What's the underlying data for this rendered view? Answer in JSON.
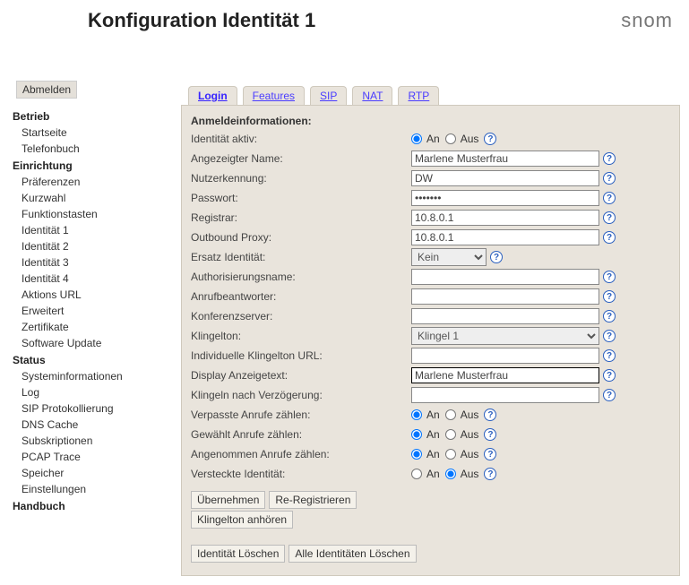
{
  "title": "Konfiguration Identität 1",
  "brand": "snom",
  "sidebar": {
    "logout": "Abmelden",
    "sections": [
      {
        "header": "Betrieb",
        "items": [
          "Startseite",
          "Telefonbuch"
        ]
      },
      {
        "header": "Einrichtung",
        "items": [
          "Präferenzen",
          "Kurzwahl",
          "Funktionstasten",
          "Identität 1",
          "Identität 2",
          "Identität 3",
          "Identität 4",
          "Aktions URL",
          "Erweitert",
          "Zertifikate",
          "Software Update"
        ]
      },
      {
        "header": "Status",
        "items": [
          "Systeminformationen",
          "Log",
          "SIP Protokollierung",
          "DNS Cache",
          "Subskriptionen",
          "PCAP Trace",
          "Speicher",
          "Einstellungen"
        ]
      },
      {
        "header": "Handbuch",
        "items": []
      }
    ]
  },
  "tabs": [
    "Login",
    "Features",
    "SIP",
    "NAT",
    "RTP"
  ],
  "active_tab": 0,
  "section_title": "Anmeldeinformationen:",
  "radio_labels": {
    "on": "An",
    "off": "Aus"
  },
  "fields": {
    "identitaet_aktiv": {
      "label": "Identität aktiv:",
      "type": "radio",
      "value": "on"
    },
    "angezeigter_name": {
      "label": "Angezeigter Name:",
      "type": "text",
      "value": "Marlene Musterfrau"
    },
    "nutzerkennung": {
      "label": "Nutzerkennung:",
      "type": "text",
      "value": "DW"
    },
    "passwort": {
      "label": "Passwort:",
      "type": "password",
      "value": "•••••••"
    },
    "registrar": {
      "label": "Registrar:",
      "type": "text",
      "value": "10.8.0.1"
    },
    "outbound_proxy": {
      "label": "Outbound Proxy:",
      "type": "text",
      "value": "10.8.0.1"
    },
    "ersatz_identitaet": {
      "label": "Ersatz Identität:",
      "type": "select-sm",
      "value": "Kein"
    },
    "auth_name": {
      "label": "Authorisierungsname:",
      "type": "text",
      "value": ""
    },
    "anrufbeantworter": {
      "label": "Anrufbeantworter:",
      "type": "text",
      "value": ""
    },
    "konferenzserver": {
      "label": "Konferenzserver:",
      "type": "text",
      "value": ""
    },
    "klingelton": {
      "label": "Klingelton:",
      "type": "select-lg",
      "value": "Klingel 1"
    },
    "ind_klingelton_url": {
      "label": "Individuelle Klingelton URL:",
      "type": "text",
      "value": ""
    },
    "display_anzeigetext": {
      "label": "Display Anzeigetext:",
      "type": "text-focus",
      "value": "Marlene Musterfrau"
    },
    "klingeln_verz": {
      "label": "Klingeln nach Verzögerung:",
      "type": "text",
      "value": ""
    },
    "verpasste": {
      "label": "Verpasste Anrufe zählen:",
      "type": "radio",
      "value": "on"
    },
    "gewaehlt": {
      "label": "Gewählt Anrufe zählen:",
      "type": "radio",
      "value": "on"
    },
    "angenommen": {
      "label": "Angenommen Anrufe zählen:",
      "type": "radio",
      "value": "on"
    },
    "versteckt": {
      "label": "Versteckte Identität:",
      "type": "radio",
      "value": "off"
    }
  },
  "buttons": {
    "uebernehmen": "Übernehmen",
    "reregistrieren": "Re-Registrieren",
    "klingelton_anhoeren": "Klingelton anhören",
    "identitaet_loeschen": "Identität Löschen",
    "alle_loeschen": "Alle Identitäten Löschen"
  }
}
